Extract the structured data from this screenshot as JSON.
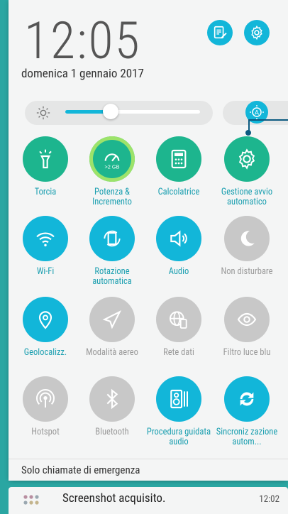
{
  "clock": {
    "time": "12:05",
    "date": "domenica 1 gennaio 2017"
  },
  "header_buttons": [
    {
      "name": "notes"
    },
    {
      "name": "settings"
    }
  ],
  "brightness": {
    "level_percent": 25,
    "auto": true
  },
  "tiles": [
    {
      "label": "Torcia",
      "state": "on",
      "icon": "flashlight-icon"
    },
    {
      "label": "Potenza & Incremento",
      "state": "on",
      "icon": "speed-boost-icon",
      "badge": ">2 GB"
    },
    {
      "label": "Calcolatrice",
      "state": "on",
      "icon": "calculator-icon"
    },
    {
      "label": "Gestione avvio automatico",
      "state": "on",
      "icon": "gear-icon"
    },
    {
      "label": "Wi-Fi",
      "state": "on",
      "icon": "wifi-icon"
    },
    {
      "label": "Rotazione automatica",
      "state": "on",
      "icon": "rotate-icon"
    },
    {
      "label": "Audio",
      "state": "on",
      "icon": "speaker-icon"
    },
    {
      "label": "Non disturbare",
      "state": "off",
      "icon": "moon-icon"
    },
    {
      "label": "Geolocalizz.",
      "state": "on",
      "icon": "location-icon"
    },
    {
      "label": "Modalità aereo",
      "state": "off",
      "icon": "airplane-icon"
    },
    {
      "label": "Rete dati",
      "state": "off",
      "icon": "globe-icon"
    },
    {
      "label": "Filtro luce blu",
      "state": "off",
      "icon": "eye-icon"
    },
    {
      "label": "Hotspot",
      "state": "off",
      "icon": "hotspot-icon"
    },
    {
      "label": "Bluetooth",
      "state": "off",
      "icon": "bluetooth-icon"
    },
    {
      "label": "Procedura guidata audio",
      "state": "on",
      "icon": "equalizer-icon"
    },
    {
      "label": "Sincroniz zazione autom...",
      "state": "on",
      "icon": "sync-icon"
    }
  ],
  "status": {
    "emergency": "Solo chiamate di emergenza"
  },
  "notification": {
    "message": "Screenshot acquisito.",
    "time": "12:02"
  }
}
